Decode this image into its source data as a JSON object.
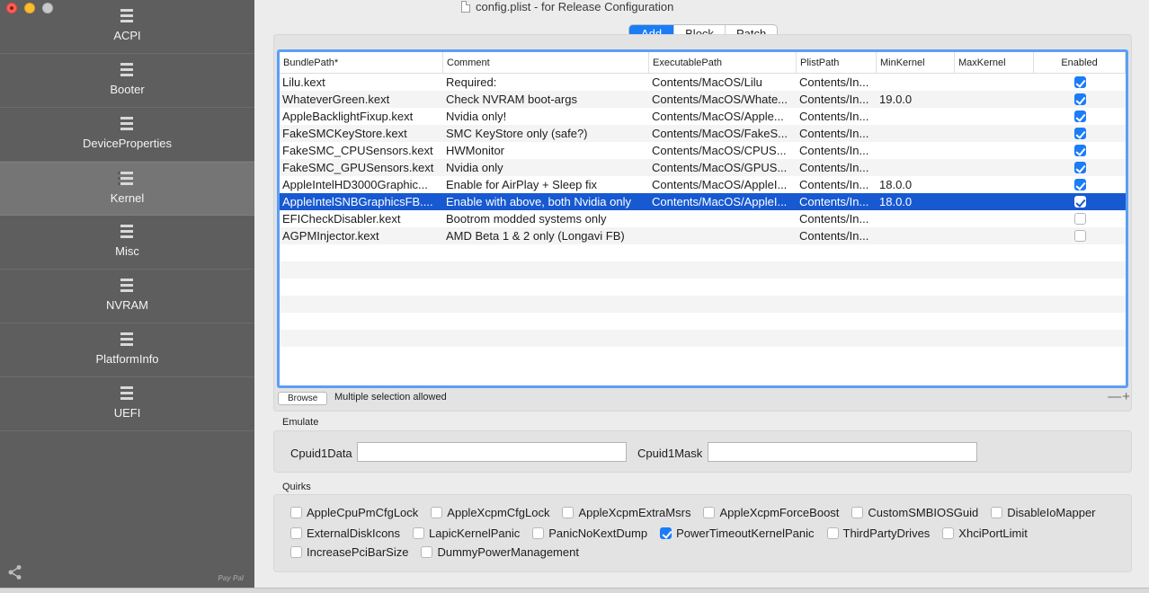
{
  "window": {
    "title": "config.plist - for Release Configuration"
  },
  "sidebar": {
    "items": [
      {
        "label": "ACPI"
      },
      {
        "label": "Booter"
      },
      {
        "label": "DeviceProperties"
      },
      {
        "label": "Kernel"
      },
      {
        "label": "Misc"
      },
      {
        "label": "NVRAM"
      },
      {
        "label": "PlatformInfo"
      },
      {
        "label": "UEFI"
      }
    ],
    "active": "Kernel",
    "donate_text": "Pay Pal"
  },
  "tabs": [
    {
      "label": "Add"
    },
    {
      "label": "Block"
    },
    {
      "label": "Patch"
    }
  ],
  "active_tab": "Add",
  "table": {
    "columns": [
      "BundlePath*",
      "Comment",
      "ExecutablePath",
      "PlistPath",
      "MinKernel",
      "MaxKernel",
      "Enabled"
    ],
    "rows": [
      {
        "bundle": "Lilu.kext",
        "comment": "Required:",
        "exec": "Contents/MacOS/Lilu",
        "plist": "Contents/In...",
        "min": "",
        "max": "",
        "enabled": true
      },
      {
        "bundle": "WhateverGreen.kext",
        "comment": "Check NVRAM boot-args",
        "exec": "Contents/MacOS/Whate...",
        "plist": "Contents/In...",
        "min": "19.0.0",
        "max": "",
        "enabled": true
      },
      {
        "bundle": "AppleBacklightFixup.kext",
        "comment": "Nvidia only!",
        "exec": "Contents/MacOS/Apple...",
        "plist": "Contents/In...",
        "min": "",
        "max": "",
        "enabled": true
      },
      {
        "bundle": "FakeSMCKeyStore.kext",
        "comment": "SMC KeyStore only (safe?)",
        "exec": "Contents/MacOS/FakeS...",
        "plist": "Contents/In...",
        "min": "",
        "max": "",
        "enabled": true
      },
      {
        "bundle": "FakeSMC_CPUSensors.kext",
        "comment": "HWMonitor",
        "exec": "Contents/MacOS/CPUS...",
        "plist": "Contents/In...",
        "min": "",
        "max": "",
        "enabled": true
      },
      {
        "bundle": "FakeSMC_GPUSensors.kext",
        "comment": "Nvidia only",
        "exec": "Contents/MacOS/GPUS...",
        "plist": "Contents/In...",
        "min": "",
        "max": "",
        "enabled": true
      },
      {
        "bundle": "AppleIntelHD3000Graphic...",
        "comment": "Enable for AirPlay + Sleep fix",
        "exec": "Contents/MacOS/AppleI...",
        "plist": "Contents/In...",
        "min": "18.0.0",
        "max": "",
        "enabled": true
      },
      {
        "bundle": "AppleIntelSNBGraphicsFB....",
        "comment": "Enable with above, both Nvidia only",
        "exec": "Contents/MacOS/AppleI...",
        "plist": "Contents/In...",
        "min": "18.0.0",
        "max": "",
        "enabled": true,
        "selected": true
      },
      {
        "bundle": "EFICheckDisabler.kext",
        "comment": "Bootrom modded systems only",
        "exec": "",
        "plist": "Contents/In...",
        "min": "",
        "max": "",
        "enabled": false
      },
      {
        "bundle": "AGPMInjector.kext",
        "comment": "AMD Beta 1 & 2 only (Longavi FB)",
        "exec": "",
        "plist": "Contents/In...",
        "min": "",
        "max": "",
        "enabled": false
      }
    ],
    "empty_rows": 7
  },
  "table_footer": {
    "browse_label": "Browse",
    "hint": "Multiple selection allowed",
    "minus_plus": "—+"
  },
  "emulate": {
    "section_label": "Emulate",
    "cpuid1data_label": "Cpuid1Data",
    "cpuid1data_value": "",
    "cpuid1mask_label": "Cpuid1Mask",
    "cpuid1mask_value": ""
  },
  "quirks": {
    "section_label": "Quirks",
    "rows": [
      [
        {
          "label": "AppleCpuPmCfgLock",
          "checked": false
        },
        {
          "label": "AppleXcpmCfgLock",
          "checked": false
        },
        {
          "label": "AppleXcpmExtraMsrs",
          "checked": false
        },
        {
          "label": "AppleXcpmForceBoost",
          "checked": false
        },
        {
          "label": "CustomSMBIOSGuid",
          "checked": false
        },
        {
          "label": "DisableIoMapper",
          "checked": false
        }
      ],
      [
        {
          "label": "ExternalDiskIcons",
          "checked": false
        },
        {
          "label": "LapicKernelPanic",
          "checked": false
        },
        {
          "label": "PanicNoKextDump",
          "checked": false
        },
        {
          "label": "PowerTimeoutKernelPanic",
          "checked": true
        },
        {
          "label": "ThirdPartyDrives",
          "checked": false
        },
        {
          "label": "XhciPortLimit",
          "checked": false
        }
      ],
      [
        {
          "label": "IncreasePciBarSize",
          "checked": false
        },
        {
          "label": "DummyPowerManagement",
          "checked": false
        }
      ]
    ]
  },
  "colors": {
    "accent": "#1a7cf6",
    "selection": "#1759d1",
    "sidebar_bg": "#5e5e5e"
  }
}
